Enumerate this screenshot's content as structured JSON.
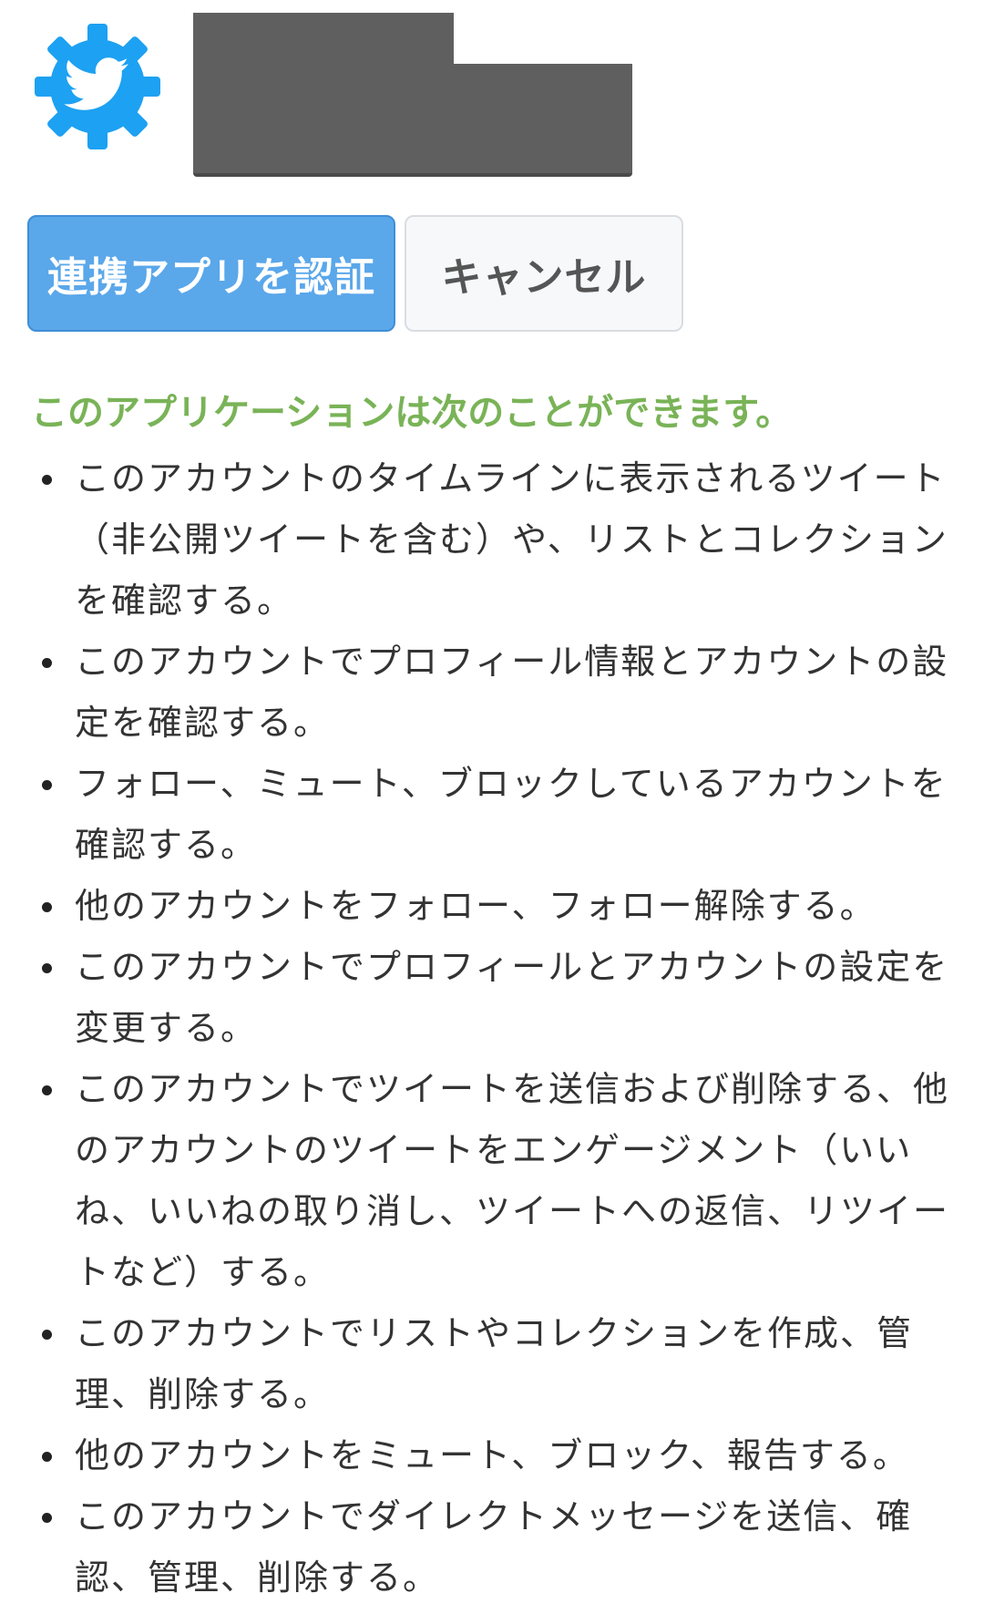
{
  "app": {
    "icon": "twitter-bird-gear-icon",
    "brand_color": "#1da1f2"
  },
  "buttons": {
    "authorize_label": "連携アプリを認証",
    "cancel_label": "キャンセル",
    "authorize_color": "#5aa7ea"
  },
  "permissions": {
    "heading": "このアプリケーションは次のことができます。",
    "heading_color": "#79b357",
    "items": [
      "このアカウントのタイムラインに表示されるツイート（非公開ツイートを含む）や、リストとコレクションを確認する。",
      "このアカウントでプロフィール情報とアカウントの設定を確認する。",
      "フォロー、ミュート、ブロックしているアカウントを確認する。",
      "他のアカウントをフォロー、フォロー解除する。",
      "このアカウントでプロフィールとアカウントの設定を変更する。",
      "このアカウントでツイートを送信および削除する、他のアカウントのツイートをエンゲージメント（いいね、いいねの取り消し、ツイートへの返信、リツイートなど）する。",
      "このアカウントでリストやコレクションを作成、管理、削除する。",
      "他のアカウントをミュート、ブロック、報告する。",
      "このアカウントでダイレクトメッセージを送信、確認、管理、削除する。"
    ]
  }
}
